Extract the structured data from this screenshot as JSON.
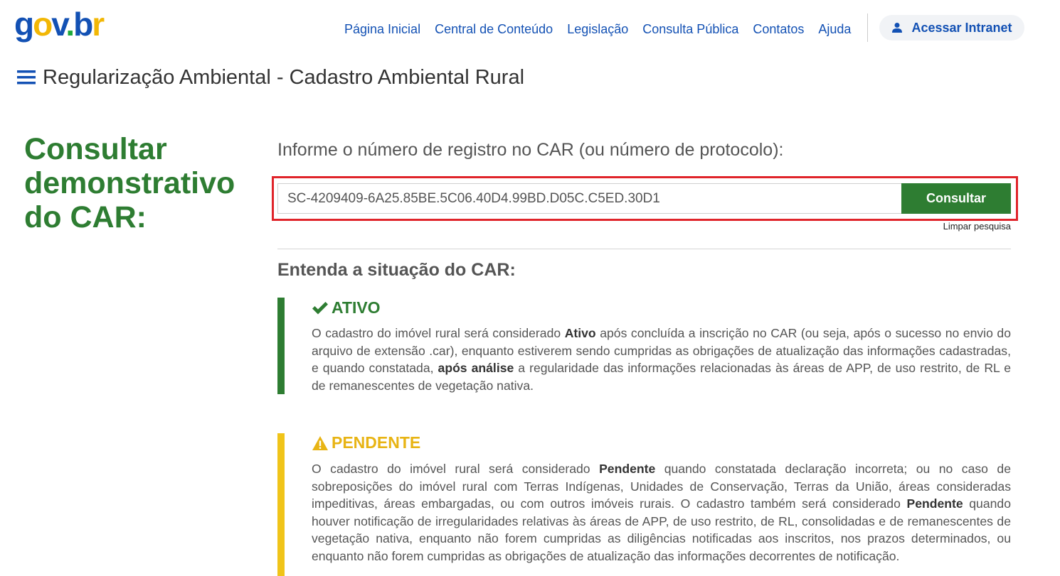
{
  "header": {
    "logo_text": "gov.br",
    "nav": [
      {
        "label": "Página Inicial"
      },
      {
        "label": "Central de Conteúdo"
      },
      {
        "label": "Legislação"
      },
      {
        "label": "Consulta Pública"
      },
      {
        "label": "Contatos"
      },
      {
        "label": "Ajuda"
      }
    ],
    "intranet_label": "Acessar Intranet"
  },
  "page": {
    "title": "Regularização Ambiental - Cadastro Ambiental Rural",
    "heading": "Consultar demonstrativo do CAR:"
  },
  "search": {
    "label": "Informe o número de registro no CAR (ou número de protocolo):",
    "value": "SC-4209409-6A25.85BE.5C06.40D4.99BD.D05C.C5ED.30D1",
    "button_label": "Consultar",
    "clear_label": "Limpar pesquisa"
  },
  "status_section": {
    "title": "Entenda a situação do CAR:",
    "ativo": {
      "label": "ATIVO",
      "text_1": "O cadastro do imóvel rural será considerado ",
      "bold_1": "Ativo",
      "text_2": " após concluída a inscrição no CAR (ou seja, após o sucesso no envio do arquivo de extensão .car), enquanto estiverem sendo cumpridas as obrigações de atualização das informações cadastradas, e quando constatada, ",
      "bold_2": "após análise",
      "text_3": " a regularidade das informações relacionadas às áreas de APP, de uso restrito, de RL e de remanescentes de vegetação nativa."
    },
    "pendente": {
      "label": "PENDENTE",
      "text_1": "O cadastro do imóvel rural será considerado ",
      "bold_1": "Pendente",
      "text_2": " quando constatada declaração incorreta; ou no caso de sobreposições do imóvel rural com Terras Indígenas, Unidades de Conservação, Terras da União, áreas consideradas impeditivas, áreas embargadas, ou com outros imóveis rurais. O cadastro também será considerado ",
      "bold_2": "Pendente",
      "text_3": " quando houver notificação de irregularidades relativas às áreas de APP, de uso restrito, de RL, consolidadas e de remanescentes de vegetação nativa, enquanto não forem cumpridas as diligências notificadas aos inscritos, nos prazos determinados, ou enquanto não forem cumpridas as obrigações de atualização das informações decorrentes de notificação."
    }
  },
  "colors": {
    "brand_blue": "#1351b4",
    "brand_green": "#2e7d32",
    "alert_yellow": "#f0c419",
    "highlight_red": "#e0242a"
  },
  "icons": {
    "menu": "hamburger-menu-icon",
    "user": "user-icon",
    "check": "check-icon",
    "warning": "warning-icon"
  }
}
